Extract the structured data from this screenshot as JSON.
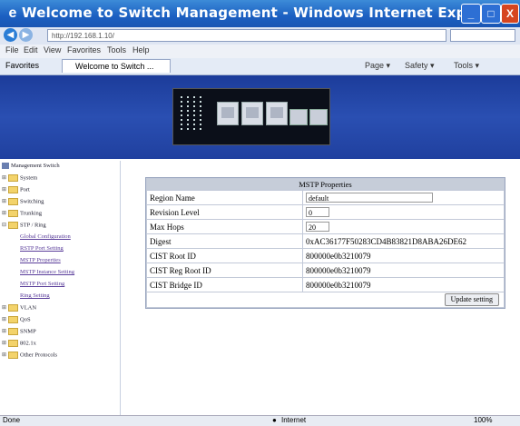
{
  "window": {
    "title": "Welcome to Switch Management - Windows Internet Explorer",
    "icon": "ie-icon",
    "buttons": {
      "minimize": "_",
      "maximize": "□",
      "close": "X"
    }
  },
  "address_bar": {
    "url": "http://192.168.1.10/",
    "icons": [
      "back-icon",
      "forward-icon",
      "refresh-icon",
      "stop-icon"
    ]
  },
  "menu": [
    "File",
    "Edit",
    "View",
    "Favorites",
    "Tools",
    "Help"
  ],
  "favorites_bar": {
    "favorites_label": "Favorites",
    "tab_label": "Welcome to Switch ...",
    "tools": [
      "Page ▾",
      "Safety ▾",
      "Tools ▾"
    ]
  },
  "sidebar": {
    "root": "Management Switch",
    "items": [
      {
        "label": "System",
        "type": "folder"
      },
      {
        "label": "Port",
        "type": "folder"
      },
      {
        "label": "Switching",
        "type": "folder"
      },
      {
        "label": "Trunking",
        "type": "folder"
      },
      {
        "label": "STP / Ring",
        "type": "folder-open"
      },
      {
        "label": "Global Configuration",
        "type": "link"
      },
      {
        "label": "RSTP Port Setting",
        "type": "link"
      },
      {
        "label": "MSTP Properties",
        "type": "link"
      },
      {
        "label": "MSTP Instance Setting",
        "type": "link"
      },
      {
        "label": "MSTP Port Setting",
        "type": "link"
      },
      {
        "label": "Ring Setting",
        "type": "link"
      },
      {
        "label": "VLAN",
        "type": "folder"
      },
      {
        "label": "QoS",
        "type": "folder"
      },
      {
        "label": "SNMP",
        "type": "folder"
      },
      {
        "label": "802.1x",
        "type": "folder"
      },
      {
        "label": "Other Protocols",
        "type": "folder"
      }
    ]
  },
  "mstp": {
    "header": "MSTP Properties",
    "rows": [
      {
        "label": "Region Name",
        "value": "default",
        "input": true,
        "input_width": "wide"
      },
      {
        "label": "Revision Level",
        "value": "0",
        "input": true,
        "input_width": "narrow"
      },
      {
        "label": "Max Hops",
        "value": "20",
        "input": true,
        "input_width": "narrow"
      },
      {
        "label": "Digest",
        "value": "0xAC36177F50283CD4B83821D8ABA26DE62",
        "input": false
      },
      {
        "label": "CIST Root ID",
        "value": "800000e0b3210079",
        "input": false
      },
      {
        "label": "CIST Reg Root ID",
        "value": "800000e0b3210079",
        "input": false
      },
      {
        "label": "CIST Bridge ID",
        "value": "800000e0b3210079",
        "input": false
      }
    ],
    "update_button": "Update setting"
  },
  "status_bar": {
    "left": "Done",
    "zone": "Internet",
    "zoom": "100%"
  }
}
